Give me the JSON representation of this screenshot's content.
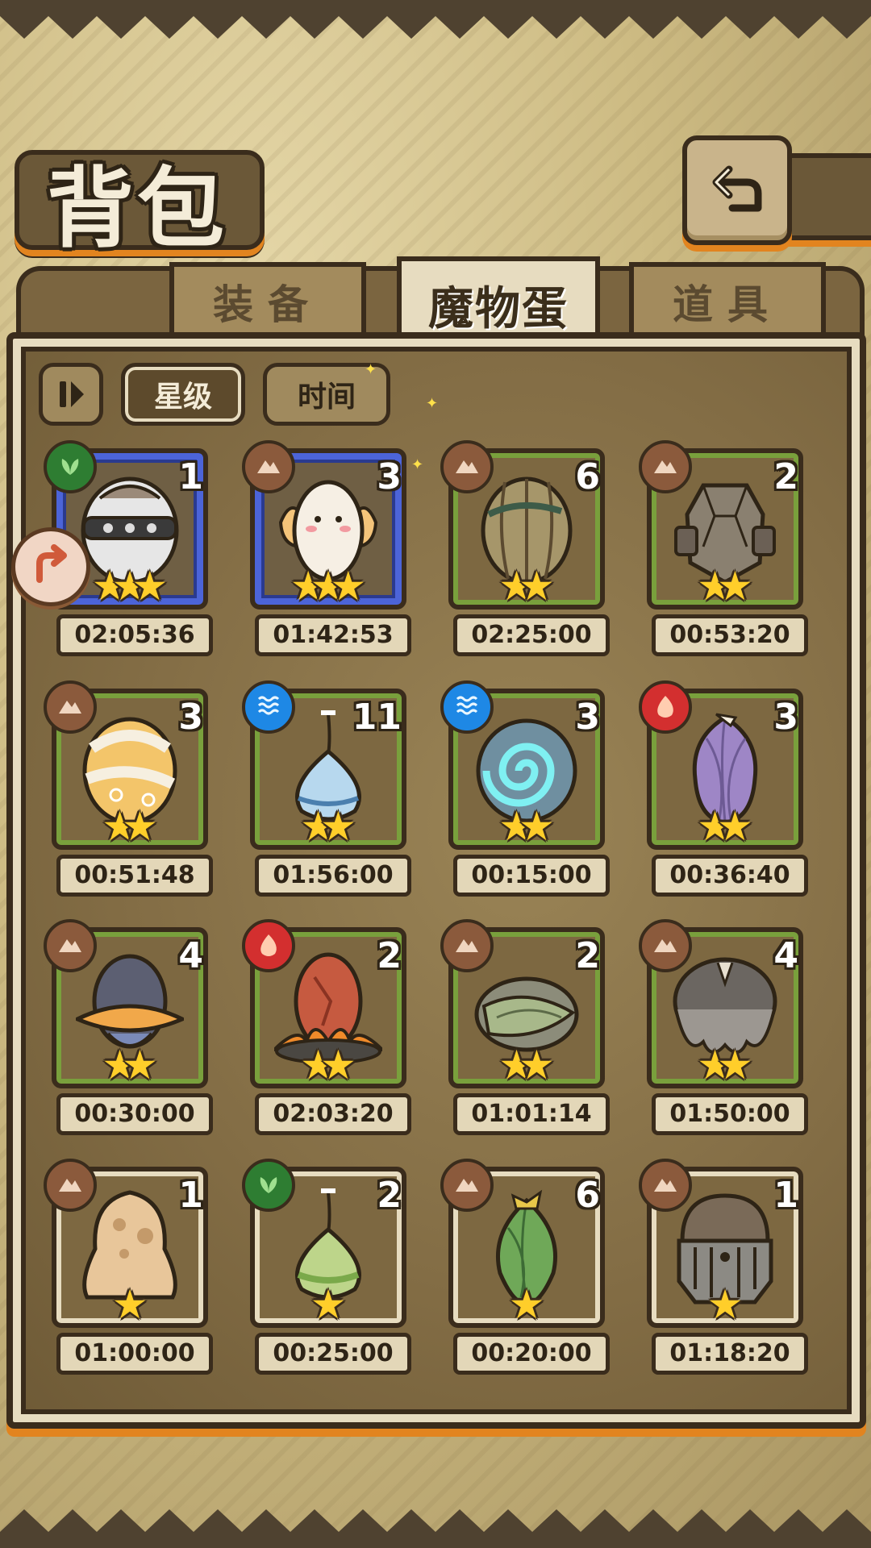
{
  "title": "背包",
  "icons": {
    "back": "back-arrow-icon",
    "share": "share-icon",
    "sort_toggle": "sort-order-icon"
  },
  "tabs": [
    {
      "label": "装备",
      "active": false
    },
    {
      "label": "魔物蛋",
      "active": true
    },
    {
      "label": "道具",
      "active": false
    }
  ],
  "sort": {
    "star_label": "星级",
    "time_label": "时间",
    "active": "星级"
  },
  "colors": {
    "earth": "#8b5a3c",
    "nature": "#2e7d32",
    "water": "#1e88e5",
    "fire": "#d32f2f",
    "rare_border": "#4c64d8",
    "common_border": "#79a03c"
  },
  "eggs": [
    {
      "element": "nature",
      "count": "1",
      "stars": 3,
      "timer": "02:05:36",
      "rare": true,
      "egg_icon": "spiked-collar-egg-icon"
    },
    {
      "element": "earth",
      "count": "3",
      "stars": 3,
      "timer": "01:42:53",
      "rare": true,
      "egg_icon": "fluffy-winged-egg-icon"
    },
    {
      "element": "earth",
      "count": "6",
      "stars": 2,
      "timer": "02:25:00",
      "rare": false,
      "egg_icon": "striped-leaf-egg-icon"
    },
    {
      "element": "earth",
      "count": "2",
      "stars": 2,
      "timer": "00:53:20",
      "rare": false,
      "egg_icon": "rock-armor-egg-icon"
    },
    {
      "element": "earth",
      "count": "3",
      "stars": 2,
      "timer": "00:51:48",
      "rare": false,
      "egg_icon": "bandaged-swirl-egg-icon"
    },
    {
      "element": "water",
      "count": "11",
      "stars": 2,
      "timer": "01:56:00",
      "rare": false,
      "egg_icon": "water-drop-egg-icon"
    },
    {
      "element": "water",
      "count": "3",
      "stars": 2,
      "timer": "00:15:00",
      "rare": false,
      "egg_icon": "spiral-shell-egg-icon"
    },
    {
      "element": "fire",
      "count": "3",
      "stars": 2,
      "timer": "00:36:40",
      "rare": false,
      "egg_icon": "purple-flower-egg-icon"
    },
    {
      "element": "earth",
      "count": "4",
      "stars": 2,
      "timer": "00:30:00",
      "rare": false,
      "egg_icon": "hat-brim-egg-icon"
    },
    {
      "element": "fire",
      "count": "2",
      "stars": 2,
      "timer": "02:03:20",
      "rare": false,
      "egg_icon": "flame-nest-egg-icon"
    },
    {
      "element": "earth",
      "count": "2",
      "stars": 2,
      "timer": "01:01:14",
      "rare": false,
      "egg_icon": "leaf-pod-egg-icon"
    },
    {
      "element": "earth",
      "count": "4",
      "stars": 2,
      "timer": "01:50:00",
      "rare": false,
      "egg_icon": "furry-mop-egg-icon"
    },
    {
      "element": "earth",
      "count": "1",
      "stars": 1,
      "timer": "01:00:00",
      "rare": false,
      "egg_icon": "melting-sand-egg-icon"
    },
    {
      "element": "nature",
      "count": "2",
      "stars": 1,
      "timer": "00:25:00",
      "rare": false,
      "egg_icon": "sprout-drop-egg-icon"
    },
    {
      "element": "earth",
      "count": "6",
      "stars": 1,
      "timer": "00:20:00",
      "rare": false,
      "egg_icon": "green-bud-egg-icon"
    },
    {
      "element": "earth",
      "count": "1",
      "stars": 1,
      "timer": "01:18:20",
      "rare": false,
      "egg_icon": "armored-dome-egg-icon"
    }
  ]
}
